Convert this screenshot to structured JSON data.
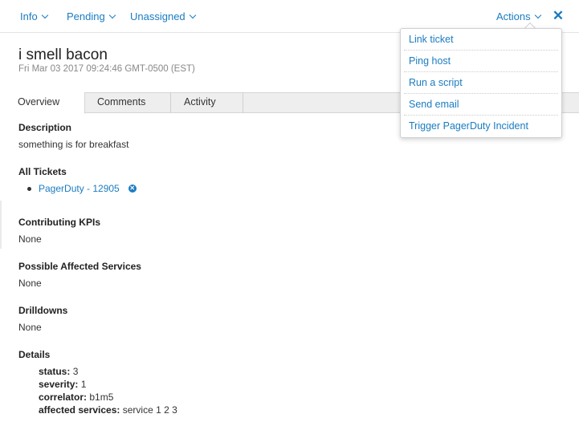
{
  "header": {
    "info_label": "Info",
    "status_label": "Pending",
    "owner_label": "Unassigned",
    "actions_label": "Actions",
    "close_glyph": "✕"
  },
  "episode": {
    "title": "i smell bacon",
    "timestamp": "Fri Mar 03 2017 09:24:46 GMT-0500 (EST)"
  },
  "tabs": [
    {
      "label": "Overview",
      "active": true
    },
    {
      "label": "Comments",
      "active": false
    },
    {
      "label": "Activity",
      "active": false
    }
  ],
  "overview": {
    "description": {
      "title": "Description",
      "value": "something is for breakfast"
    },
    "all_tickets": {
      "title": "All Tickets",
      "items": [
        {
          "label": "PagerDuty - 12905",
          "remove_icon": "x-circle-icon"
        }
      ]
    },
    "contributing_kpis": {
      "title": "Contributing KPIs",
      "value": "None"
    },
    "affected_services": {
      "title": "Possible Affected Services",
      "value": "None"
    },
    "drilldowns": {
      "title": "Drilldowns",
      "value": "None"
    },
    "details": {
      "title": "Details",
      "rows": [
        {
          "key": "status:",
          "value": "3"
        },
        {
          "key": "severity:",
          "value": "1"
        },
        {
          "key": "correlator:",
          "value": "b1m5"
        },
        {
          "key": "affected services:",
          "value": "service 1 2 3"
        }
      ]
    }
  },
  "actions_menu": {
    "items": [
      {
        "label": "Link ticket"
      },
      {
        "label": "Ping host"
      },
      {
        "label": "Run a script"
      },
      {
        "label": "Send email"
      },
      {
        "label": "Trigger PagerDuty Incident"
      }
    ]
  },
  "colors": {
    "accent": "#1a7cc1",
    "text": "#333333",
    "muted": "#888888",
    "tab_bg": "#eeeeee"
  }
}
